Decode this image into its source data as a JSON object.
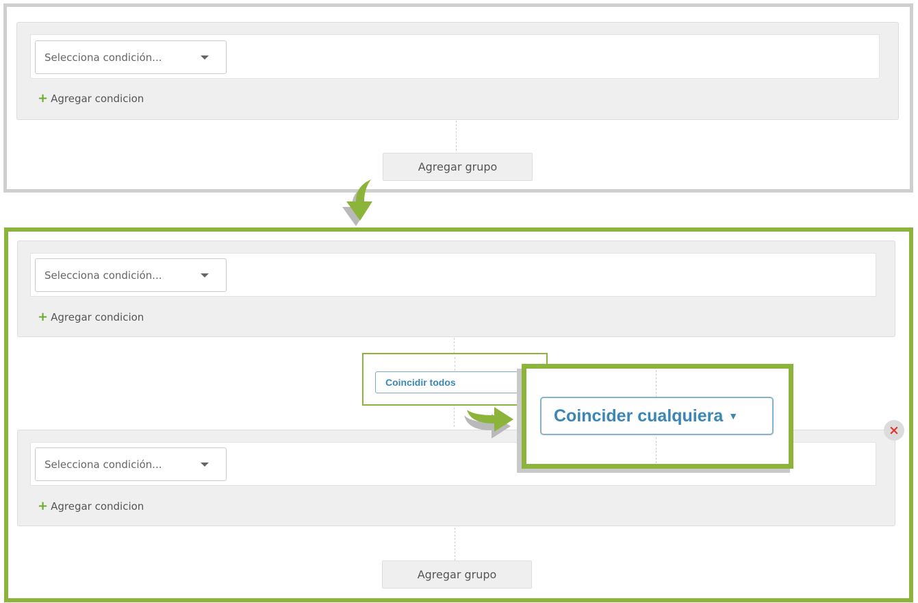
{
  "top_panel": {
    "group": {
      "select_placeholder": "Selecciona condición...",
      "add_condition_label": "Agregar condicion"
    },
    "add_group_label": "Agregar grupo"
  },
  "bottom_panel": {
    "groups": [
      {
        "select_placeholder": "Selecciona condición...",
        "add_condition_label": "Agregar condicion"
      },
      {
        "select_placeholder": "Selecciona condición...",
        "add_condition_label": "Agregar condicion"
      }
    ],
    "match_select_value": "Coincidir todos",
    "match_zoom_value": "Coincider cualquiera",
    "add_group_label": "Agregar grupo"
  },
  "icons": {
    "plus": "+",
    "remove": "×",
    "dropdown": "▼"
  },
  "colors": {
    "accent_green": "#8cb43a",
    "plus_green": "#6aab2d",
    "link_blue": "#3a87b6",
    "remove_red": "#e3342f"
  }
}
